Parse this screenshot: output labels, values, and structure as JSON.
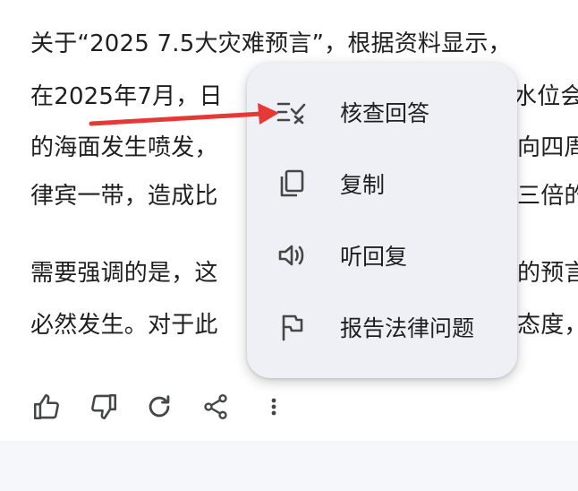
{
  "answer": {
    "paragraph1": [
      "关于“2025 7.5大灾难预言”，根据资料显示，",
      "在2025年7月，日",
      "的海面发生喷发，",
      "律宾一带，造成比"
    ],
    "paragraph1_right": [
      "",
      "水位会",
      "向四周",
      "三倍的"
    ],
    "paragraph2": [
      "需要强调的是，这",
      "必然发生。对于此"
    ],
    "paragraph2_right": [
      "的预言",
      "态度，"
    ]
  },
  "actions": [
    {
      "icon": "thumbs-up-icon"
    },
    {
      "icon": "thumbs-down-icon"
    },
    {
      "icon": "regenerate-icon"
    },
    {
      "icon": "share-icon"
    },
    {
      "icon": "more-vert-icon"
    }
  ],
  "menu": {
    "items": [
      {
        "label": "核查回答",
        "icon": "double-check-icon"
      },
      {
        "label": "复制",
        "icon": "copy-icon"
      },
      {
        "label": "听回复",
        "icon": "speaker-icon"
      },
      {
        "label": "报告法律问题",
        "icon": "flag-icon"
      }
    ]
  },
  "colors": {
    "annotation_arrow": "#e53935",
    "menu_background": "#eef0f6",
    "text": "#1f1f1f",
    "icon": "#444746"
  }
}
